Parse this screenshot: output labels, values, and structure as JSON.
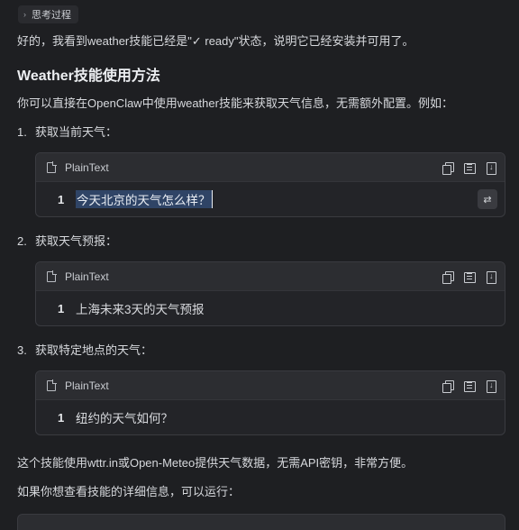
{
  "think_toggle": {
    "label": "思考过程"
  },
  "intro": "好的，我看到weather技能已经是\"✓ ready\"状态，说明它已经安装并可用了。",
  "heading": "Weather技能使用方法",
  "lead": "你可以直接在OpenClaw中使用weather技能来获取天气信息，无需额外配置。例如：",
  "examples": [
    {
      "num": "1.",
      "title": "获取当前天气：",
      "lang": "PlainText",
      "line": "1",
      "code": "今天北京的天气怎么样？"
    },
    {
      "num": "2.",
      "title": "获取天气预报：",
      "lang": "PlainText",
      "line": "1",
      "code": "上海未来3天的天气预报"
    },
    {
      "num": "3.",
      "title": "获取特定地点的天气：",
      "lang": "PlainText",
      "line": "1",
      "code": "纽约的天气如何？"
    }
  ],
  "note": "这个技能使用wttr.in或Open-Meteo提供天气数据，无需API密钥，非常方便。",
  "more": "如果你想查看技能的详细信息，可以运行：",
  "inline_action": {
    "label": "⇄"
  },
  "colors": {
    "background": "#1e1f22",
    "code_header": "#2c2d31",
    "selection": "#2f4466"
  }
}
